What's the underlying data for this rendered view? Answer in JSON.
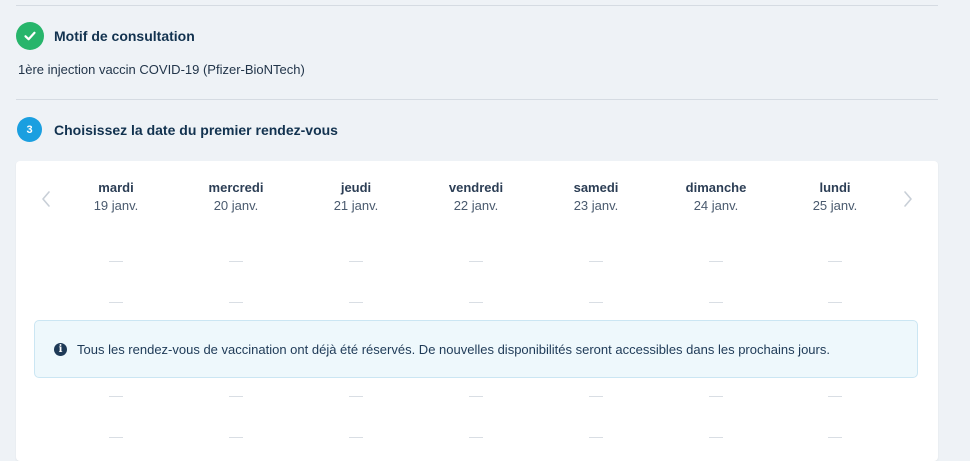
{
  "steps": {
    "motif": {
      "title": "Motif de consultation",
      "selected_value": "1ère injection vaccin COVID-19 (Pfizer-BioNTech)",
      "icon": "check-icon",
      "badge_color": "#27b56b"
    },
    "date": {
      "number": "3",
      "title": "Choisissez la date du premier rendez-vous",
      "badge_color": "#1a9fe0"
    }
  },
  "calendar": {
    "prev_icon": "chevron-left-icon",
    "next_icon": "chevron-right-icon",
    "days": [
      {
        "name": "mardi",
        "date": "19 janv."
      },
      {
        "name": "mercredi",
        "date": "20 janv."
      },
      {
        "name": "jeudi",
        "date": "21 janv."
      },
      {
        "name": "vendredi",
        "date": "22 janv."
      },
      {
        "name": "samedi",
        "date": "23 janv."
      },
      {
        "name": "dimanche",
        "date": "24 janv."
      },
      {
        "name": "lundi",
        "date": "25 janv."
      }
    ],
    "empty_slot_rows": 4,
    "alert": {
      "icon": "info-icon",
      "message": "Tous les rendez-vous de vaccination ont déjà été réservés. De nouvelles disponibilités seront accessibles dans les prochains jours."
    }
  }
}
